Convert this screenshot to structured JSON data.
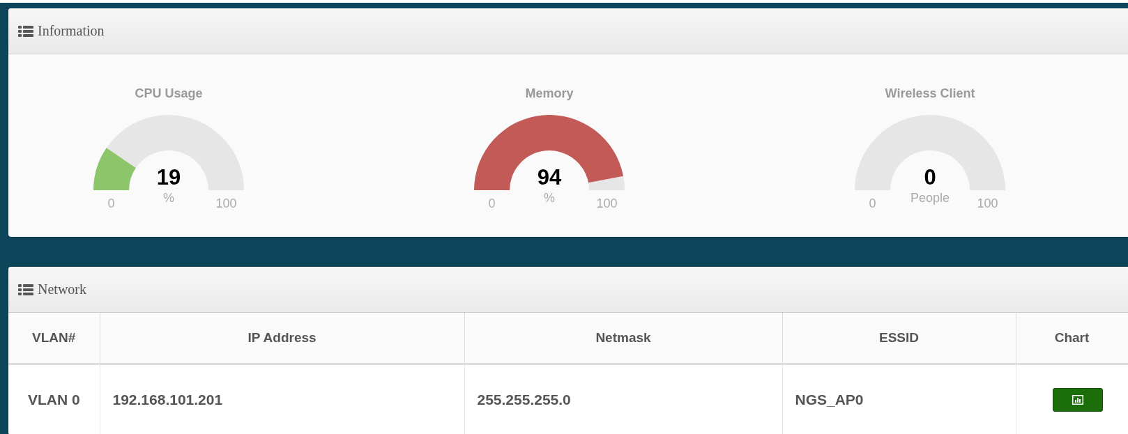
{
  "information": {
    "title": "Information",
    "gauges": [
      {
        "label": "CPU Usage",
        "value": "19",
        "unit": "%",
        "min": "0",
        "max": "100",
        "level": 0.19,
        "color": "#8cc56a"
      },
      {
        "label": "Memory",
        "value": "94",
        "unit": "%",
        "min": "0",
        "max": "100",
        "level": 0.94,
        "color": "#c25a57"
      },
      {
        "label": "Wireless Client",
        "value": "0",
        "unit": "People",
        "min": "0",
        "max": "100"
      }
    ]
  },
  "network": {
    "title": "Network",
    "table": {
      "columns": [
        "VLAN#",
        "IP Address",
        "Netmask",
        "ESSID",
        "Chart"
      ],
      "rows": [
        {
          "cells": [
            "VLAN 0",
            "192.168.101.201",
            "255.255.255.0",
            "NGS_AP0"
          ]
        }
      ]
    }
  }
}
